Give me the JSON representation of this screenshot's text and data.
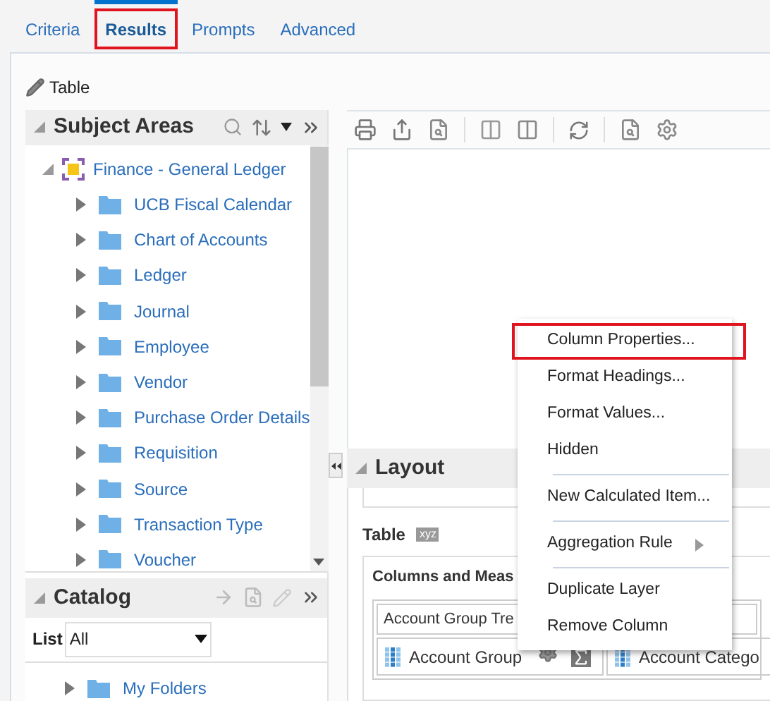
{
  "tabs": [
    {
      "label": "Criteria",
      "selected": false,
      "highlighted": false
    },
    {
      "label": "Results",
      "selected": true,
      "highlighted": true
    },
    {
      "label": "Prompts",
      "selected": false,
      "highlighted": false
    },
    {
      "label": "Advanced",
      "selected": false,
      "highlighted": false
    }
  ],
  "view_title": "Table",
  "subject_areas": {
    "title": "Subject Areas",
    "tree": [
      {
        "label": "Finance - General Ledger",
        "expanded": true,
        "children": [
          {
            "label": "UCB Fiscal Calendar",
            "expanded": false
          },
          {
            "label": "Chart of Accounts",
            "expanded": false
          },
          {
            "label": "Ledger",
            "expanded": false
          },
          {
            "label": "Journal",
            "expanded": false
          },
          {
            "label": "Employee",
            "expanded": false
          },
          {
            "label": "Vendor",
            "expanded": false
          },
          {
            "label": "Purchase Order Details",
            "expanded": false
          },
          {
            "label": "Requisition",
            "expanded": false
          },
          {
            "label": "Source",
            "expanded": false
          },
          {
            "label": "Transaction Type",
            "expanded": false
          },
          {
            "label": "Voucher",
            "expanded": false
          }
        ]
      }
    ]
  },
  "catalog": {
    "title": "Catalog",
    "list_label": "List",
    "list_value": "All",
    "tree": [
      {
        "label": "My Folders",
        "expanded": false
      }
    ]
  },
  "layout": {
    "title": "Layout",
    "view_label": "Table",
    "view_badge": "xyz",
    "section_title": "Columns and Meas",
    "group_header": "Account Group Tre",
    "columns": [
      "Account Group",
      "Account Catego"
    ]
  },
  "context_menu": [
    {
      "kind": "item",
      "label": "Column Properties...",
      "highlighted": true
    },
    {
      "kind": "item",
      "label": "Format Headings...",
      "highlighted": false
    },
    {
      "kind": "item",
      "label": "Format Values...",
      "highlighted": false
    },
    {
      "kind": "item",
      "label": "Hidden",
      "highlighted": false
    },
    {
      "kind": "separator"
    },
    {
      "kind": "item",
      "label": "New Calculated Item...",
      "highlighted": false
    },
    {
      "kind": "separator"
    },
    {
      "kind": "submenu",
      "label": "Aggregation Rule",
      "highlighted": false
    },
    {
      "kind": "separator"
    },
    {
      "kind": "item",
      "label": "Duplicate Layer",
      "highlighted": false
    },
    {
      "kind": "item",
      "label": "Remove Column",
      "highlighted": false
    }
  ]
}
